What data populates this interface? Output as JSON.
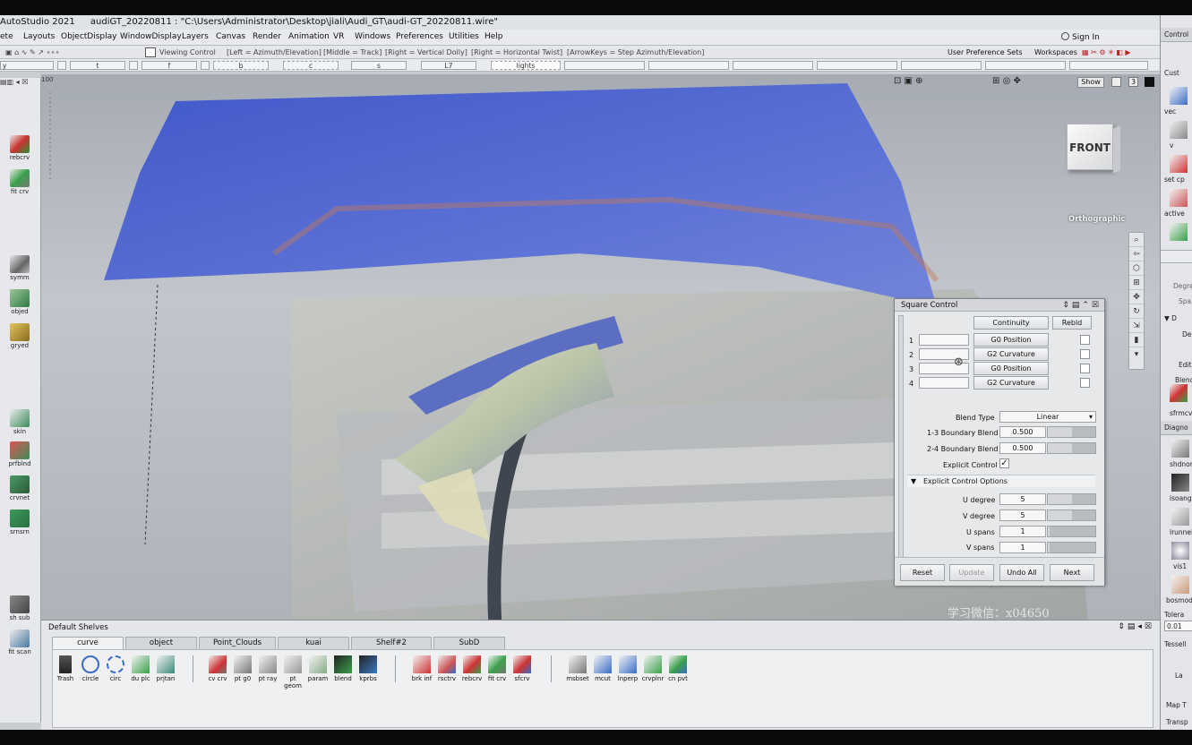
{
  "title": {
    "app": "AutoStudio 2021",
    "file": "audiGT_20220811 : \"C:\\Users\\Administrator\\Desktop\\jiali\\Audi_GT\\audi-GT_20220811.wire\""
  },
  "menu": [
    "ete",
    "Layouts",
    "ObjectDisplay",
    "WindowDisplay",
    "Layers",
    "Canvas",
    "Render",
    "Animation",
    "VR",
    "Windows",
    "Preferences",
    "Utilities",
    "Help"
  ],
  "sign_in": "Sign In",
  "user_row": {
    "pref_sets": "User Preference Sets",
    "workspaces": "Workspaces"
  },
  "control_tab": "Control",
  "toolbar_hints": {
    "viewing": "Viewing Control",
    "left": "[Left = Azimuth/Elevation]",
    "middle": "[Middle = Track]",
    "right1": "[Right = Vertical Dolly]",
    "right2": "[Right = Horizontal Twist]",
    "arrows": "[ArrowKeys = Step Azimuth/Elevation]"
  },
  "toolbar2_cells": [
    "y",
    "l",
    "t",
    "f",
    "b",
    "c",
    "s",
    "L7",
    "lights"
  ],
  "left_tools": [
    {
      "label": "rebcrv"
    },
    {
      "label": "fit crv"
    },
    {
      "label": "symm"
    },
    {
      "label": "objed"
    },
    {
      "label": "gryed"
    },
    {
      "label": "skin"
    },
    {
      "label": "prfblnd"
    },
    {
      "label": "crvnet"
    },
    {
      "label": "srnsrn"
    },
    {
      "label": "sh sub"
    },
    {
      "label": "fit scan"
    }
  ],
  "viewport": {
    "show_label": "Show",
    "page_num": "3",
    "view_cube_label": "FRONT",
    "view_mode": "Orthographic",
    "watermark": "学习微信：x04650",
    "ruler": "100"
  },
  "dialog": {
    "title": "Square Control",
    "continuity_btn": "Continuity",
    "rebld_btn": "Rebld",
    "rows": [
      {
        "n": "1",
        "mode": "G0 Position"
      },
      {
        "n": "2",
        "mode": "G2 Curvature"
      },
      {
        "n": "3",
        "mode": "G0 Position"
      },
      {
        "n": "4",
        "mode": "G2 Curvature"
      }
    ],
    "blend_type_label": "Blend Type",
    "blend_type_value": "Linear",
    "b13_label": "1-3 Boundary Blend",
    "b13_value": "0.500",
    "b24_label": "2-4 Boundary Blend",
    "b24_value": "0.500",
    "explicit_label": "Explicit Control",
    "explicit_checked": "✓",
    "options_header": "Explicit Control Options",
    "u_degree_label": "U degree",
    "u_degree": "5",
    "v_degree_label": "V degree",
    "v_degree": "5",
    "u_spans_label": "U spans",
    "u_spans": "1",
    "v_spans_label": "V spans",
    "v_spans": "1",
    "reset": "Reset",
    "update": "Update",
    "undo_all": "Undo All",
    "next": "Next"
  },
  "shelves": {
    "title": "Default Shelves",
    "tabs": [
      "curve",
      "object",
      "Point_Clouds",
      "kuai",
      "Shelf#2",
      "SubD"
    ],
    "tools": [
      "Trash",
      "circle",
      "circ",
      "du plc",
      "prjtan",
      "cv crv",
      "pt g0",
      "pt ray",
      "pt geom",
      "param",
      "blend",
      "kprbs",
      "brk inf",
      "rsctrv",
      "rebcrv",
      "fit crv",
      "sfcrv",
      "msbset",
      "mcut",
      "lnperp",
      "crvplnr",
      "cn pvt"
    ]
  },
  "right_pane": [
    "Cust",
    "vec",
    "v",
    "set cp",
    "active",
    "Degre",
    "Spa",
    "D",
    "De",
    "Edit",
    "Blend",
    "sfrmcv",
    "Diagno",
    "shdnorm",
    "isoang",
    "lrunnel",
    "vis1",
    "bosmod",
    "Tolera",
    "0.01",
    "Tessell",
    "La",
    "Map T",
    "Transp"
  ]
}
